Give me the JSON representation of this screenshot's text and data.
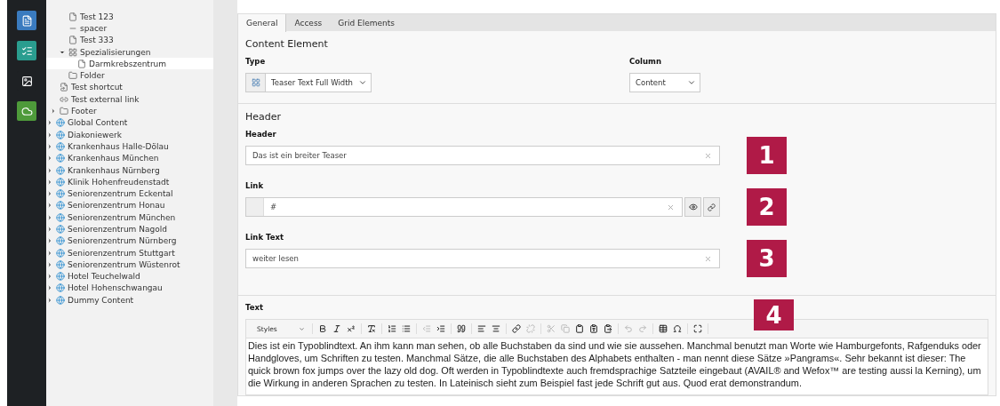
{
  "module_bar": {
    "items": [
      {
        "kind": "page",
        "color": "#3a7bbf"
      },
      {
        "kind": "list",
        "color": "#2a9d8f"
      },
      {
        "kind": "image",
        "color": "#1e2124"
      },
      {
        "kind": "cloud",
        "color": "#4e9a3a"
      }
    ]
  },
  "tree": {
    "items": [
      {
        "children": [
          {
            "children": [
              {
                "label": "Test 123",
                "kind": "page",
                "selected": false
              },
              {
                "label": "spacer",
                "kind": "spacer",
                "selected": false
              },
              {
                "label": "Test 333",
                "kind": "page",
                "selected": false
              },
              {
                "label": "Spezialisierungen",
                "kind": "grid",
                "selected": false,
                "expanded": true,
                "children": [
                  {
                    "label": "Darmkrebszentrum",
                    "kind": "page",
                    "selected": true
                  }
                ]
              },
              {
                "label": "Folder",
                "kind": "folder",
                "selected": false
              }
            ]
          },
          {
            "label": "Test shortcut",
            "kind": "shortcut",
            "selected": false
          },
          {
            "label": "Test external link",
            "kind": "link",
            "selected": false
          },
          {
            "label": "Footer",
            "kind": "folder",
            "selected": false,
            "expanded": false
          }
        ]
      },
      {
        "label": "Global Content",
        "kind": "globe",
        "selected": false,
        "expanded": false
      },
      {
        "label": "Diakoniewerk",
        "kind": "globe",
        "selected": false,
        "expanded": false
      },
      {
        "label": "Krankenhaus Halle-Dölau",
        "kind": "globe",
        "selected": false,
        "expanded": false
      },
      {
        "label": "Krankenhaus München",
        "kind": "globe",
        "selected": false,
        "expanded": false
      },
      {
        "label": "Krankenhaus Nürnberg",
        "kind": "globe",
        "selected": false,
        "expanded": false
      },
      {
        "label": "Klinik Hohenfreudenstadt",
        "kind": "globe",
        "selected": false,
        "expanded": false
      },
      {
        "label": "Seniorenzentrum Eckental",
        "kind": "globe",
        "selected": false,
        "expanded": false
      },
      {
        "label": "Seniorenzentrum Honau",
        "kind": "globe",
        "selected": false,
        "expanded": false
      },
      {
        "label": "Seniorenzentrum München",
        "kind": "globe",
        "selected": false,
        "expanded": false
      },
      {
        "label": "Seniorenzentrum Nagold",
        "kind": "globe",
        "selected": false,
        "expanded": false
      },
      {
        "label": "Seniorenzentrum Nürnberg",
        "kind": "globe",
        "selected": false,
        "expanded": false
      },
      {
        "label": "Seniorenzentrum Stuttgart",
        "kind": "globe",
        "selected": false,
        "expanded": false
      },
      {
        "label": "Seniorenzentrum Wüstenrot",
        "kind": "globe",
        "selected": false,
        "expanded": false
      },
      {
        "label": "Hotel Teuchelwald",
        "kind": "globe",
        "selected": false,
        "expanded": false
      },
      {
        "label": "Hotel Hohenschwangau",
        "kind": "globe",
        "selected": false,
        "expanded": false
      },
      {
        "label": "Dummy Content",
        "kind": "globe",
        "selected": false,
        "expanded": false
      }
    ]
  },
  "tabs": [
    {
      "label": "General",
      "selected": true
    },
    {
      "label": "Access",
      "selected": false
    },
    {
      "label": "Grid Elements",
      "selected": false
    }
  ],
  "content_element": {
    "title": "Content Element",
    "type_label": "Type",
    "type_value": "Teaser Text Full Width",
    "column_label": "Column",
    "column_value": "Content"
  },
  "header_section": {
    "title": "Header",
    "fields": [
      {
        "label": "Header",
        "value": "Das ist ein breiter Teaser",
        "kind": "text",
        "marker": "1"
      },
      {
        "label": "Link",
        "value": "#",
        "kind": "link",
        "marker": "2"
      },
      {
        "label": "Link Text",
        "value": "weiter lesen",
        "kind": "text",
        "marker": "3"
      }
    ]
  },
  "text_section": {
    "label": "Text",
    "marker": "4",
    "styles_label": "Styles",
    "toolbar": [
      [
        {
          "kind": "bold",
          "disabled": false
        },
        {
          "kind": "italic",
          "disabled": false
        },
        {
          "kind": "superscript",
          "disabled": false
        }
      ],
      [
        {
          "kind": "clear-format",
          "disabled": false
        }
      ],
      [
        {
          "kind": "ordered-list",
          "disabled": false
        },
        {
          "kind": "bullet-list",
          "disabled": false
        }
      ],
      [
        {
          "kind": "outdent",
          "disabled": true
        },
        {
          "kind": "indent",
          "disabled": false
        }
      ],
      [
        {
          "kind": "quote",
          "disabled": false
        }
      ],
      [
        {
          "kind": "align-left",
          "disabled": false
        },
        {
          "kind": "align-center",
          "disabled": false
        }
      ],
      [
        {
          "kind": "link",
          "disabled": false
        },
        {
          "kind": "unlink",
          "disabled": true
        }
      ],
      [
        {
          "kind": "cut",
          "disabled": true
        },
        {
          "kind": "copy",
          "disabled": true
        },
        {
          "kind": "paste",
          "disabled": false
        },
        {
          "kind": "paste-text",
          "disabled": false
        },
        {
          "kind": "paste-word",
          "disabled": false
        }
      ],
      [
        {
          "kind": "undo",
          "disabled": true
        },
        {
          "kind": "redo",
          "disabled": true
        }
      ],
      [
        {
          "kind": "table",
          "disabled": false
        },
        {
          "kind": "special-char",
          "disabled": false
        }
      ],
      [
        {
          "kind": "maximize",
          "disabled": false
        }
      ]
    ],
    "body": "Dies ist ein Typoblindtext. An ihm kann man sehen, ob alle Buchstaben da sind und wie sie aussehen. Manchmal benutzt man Worte wie Hamburgefonts, Rafgenduks oder Handgloves, um Schriften zu testen. Manchmal Sätze, die alle Buchstaben des Alphabets enthalten - man nennt diese Sätze »Pangrams«. Sehr bekannt ist dieser: The quick brown fox jumps over the lazy old dog. Oft werden in Typoblindtexte auch fremdsprachige Satzteile eingebaut (AVAIL® and Wefox™ are testing aussi la Kerning), um die Wirkung in anderen Sprachen zu testen. In Lateinisch sieht zum Beispiel fast jede Schrift gut aus. Quod erat demonstrandum."
  }
}
